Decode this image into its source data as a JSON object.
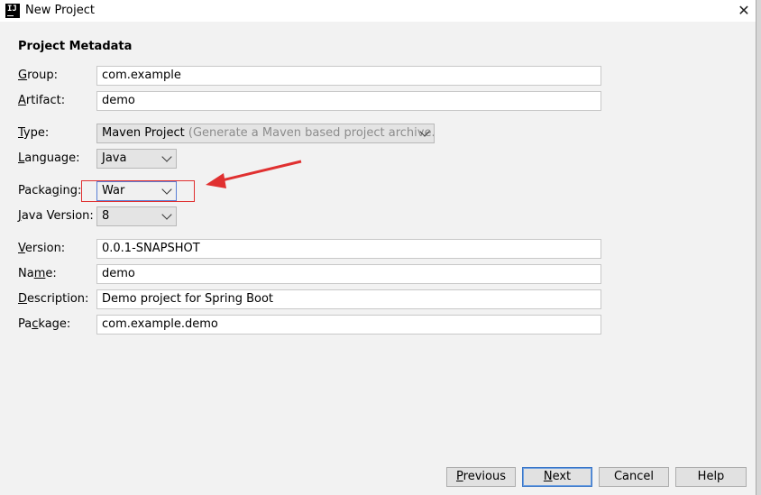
{
  "window": {
    "title": "New Project",
    "app_icon_text": "IJ"
  },
  "section": {
    "heading": "Project Metadata"
  },
  "form": {
    "group": {
      "label_mnemonic": "G",
      "label_rest": "roup:",
      "value": "com.example"
    },
    "artifact": {
      "label_mnemonic": "A",
      "label_rest": "rtifact:",
      "value": "demo"
    },
    "type": {
      "label_mnemonic": "T",
      "label_rest": "ype:",
      "value": "Maven Project",
      "hint": "(Generate a Maven based project archive.)"
    },
    "language": {
      "label_mnemonic": "L",
      "label_rest": "anguage:",
      "value": "Java"
    },
    "packaging": {
      "label_before": "Packa",
      "label_mnemonic": "g",
      "label_after": "ing:",
      "value": "War"
    },
    "java_version": {
      "label_mnemonic": "J",
      "label_rest": "ava Version:",
      "value": "8"
    },
    "version": {
      "label_mnemonic": "V",
      "label_rest": "ersion:",
      "value": "0.0.1-SNAPSHOT"
    },
    "name": {
      "label_before": "Na",
      "label_mnemonic": "m",
      "label_after": "e:",
      "value": "demo"
    },
    "description": {
      "label_mnemonic": "D",
      "label_rest": "escription:",
      "value": "Demo project for Spring Boot"
    },
    "package": {
      "label_before": "Pa",
      "label_mnemonic": "c",
      "label_after": "kage:",
      "value": "com.example.demo"
    }
  },
  "buttons": {
    "previous": {
      "mnemonic": "P",
      "rest": "revious"
    },
    "next": {
      "mnemonic": "N",
      "rest": "ext"
    },
    "cancel": "Cancel",
    "help": "Help"
  },
  "annotation": {
    "color": "#e03030"
  }
}
